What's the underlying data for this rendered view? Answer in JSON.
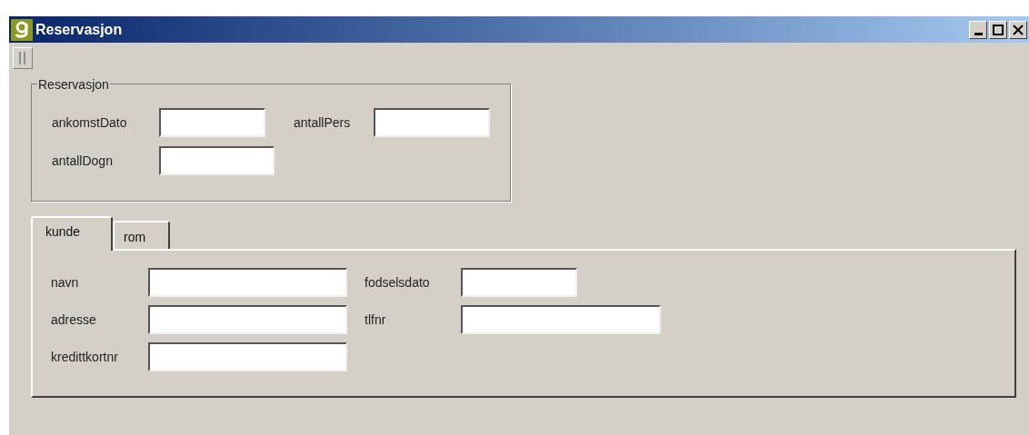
{
  "window": {
    "title": "Reservasjon"
  },
  "group": {
    "title": "Reservasjon",
    "rows": [
      [
        {
          "label": "ankomstDato"
        },
        {
          "label": "antallPers"
        }
      ],
      [
        {
          "label": "antallDogn"
        }
      ]
    ]
  },
  "tabs": [
    {
      "label": "kunde",
      "selected": true
    },
    {
      "label": "rom",
      "selected": false
    }
  ],
  "panel": {
    "rows": [
      [
        {
          "label": "navn"
        },
        {
          "label": "fodselsdato"
        }
      ],
      [
        {
          "label": "adresse"
        },
        {
          "label": "tlfnr"
        }
      ],
      [
        {
          "label": "kredittkortnr"
        }
      ]
    ]
  }
}
